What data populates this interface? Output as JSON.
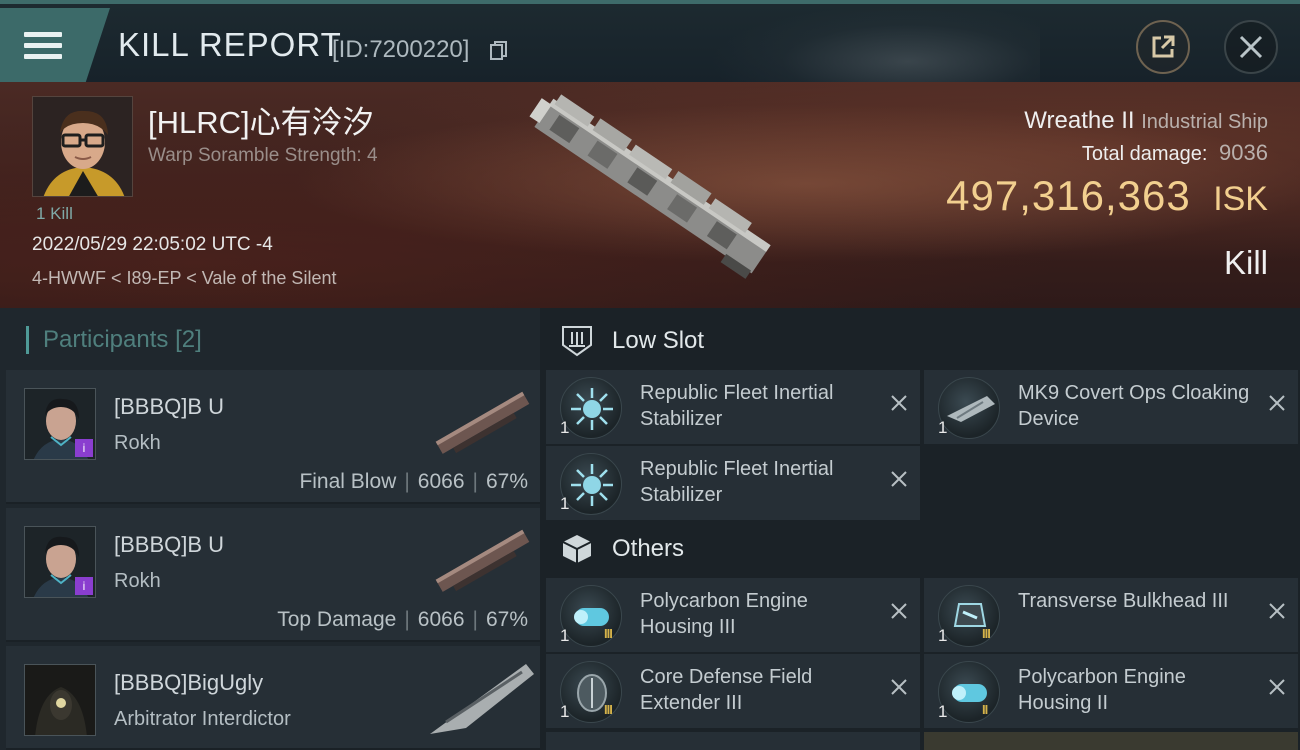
{
  "header": {
    "title": "KILL REPORT",
    "id_text": "[ID:7200220]"
  },
  "victim": {
    "name": "[HLRC]心有泠汐",
    "sub": "Warp Soramble Strength: 4",
    "kills": "1 Kill",
    "timestamp": "2022/05/29 22:05:02 UTC -4",
    "location": "4-HWWF < I89-EP < Vale of the Silent",
    "ship_name": "Wreathe II",
    "ship_class": "Industrial Ship",
    "damage_label": "Total damage:",
    "damage_value": "9036",
    "isk_value": "497,316,363",
    "isk_unit": "ISK",
    "result": "Kill"
  },
  "participants": {
    "label": "Participants",
    "count": "[2]",
    "items": [
      {
        "name": "[BBBQ]B U",
        "ship": "Rokh",
        "role": "Final Blow",
        "damage": "6066",
        "percent": "67%",
        "badge": "i"
      },
      {
        "name": "[BBBQ]B U",
        "ship": "Rokh",
        "role": "Top Damage",
        "damage": "6066",
        "percent": "67%",
        "badge": "i"
      },
      {
        "name": "[BBBQ]BigUgly",
        "ship": "Arbitrator Interdictor"
      }
    ]
  },
  "fitting": {
    "low_slot_label": "Low Slot",
    "others_label": "Others",
    "low_slot": [
      {
        "name": "Republic Fleet Inertial Stabilizer",
        "qty": "1",
        "tier": ""
      },
      {
        "name": "MK9 Covert Ops Cloaking Device",
        "qty": "1",
        "tier": ""
      },
      {
        "name": "Republic Fleet Inertial Stabilizer",
        "qty": "1",
        "tier": ""
      }
    ],
    "others": [
      {
        "name": "Polycarbon Engine Housing III",
        "qty": "1",
        "tier": "III"
      },
      {
        "name": "Transverse Bulkhead III",
        "qty": "1",
        "tier": "III"
      },
      {
        "name": "Core Defense Field Extender III",
        "qty": "1",
        "tier": "III"
      },
      {
        "name": "Polycarbon Engine Housing II",
        "qty": "1",
        "tier": "II"
      }
    ]
  },
  "colors": {
    "accent": "#3c6a69",
    "isk": "#f2cf8f",
    "badge": "#8a3ecf"
  }
}
